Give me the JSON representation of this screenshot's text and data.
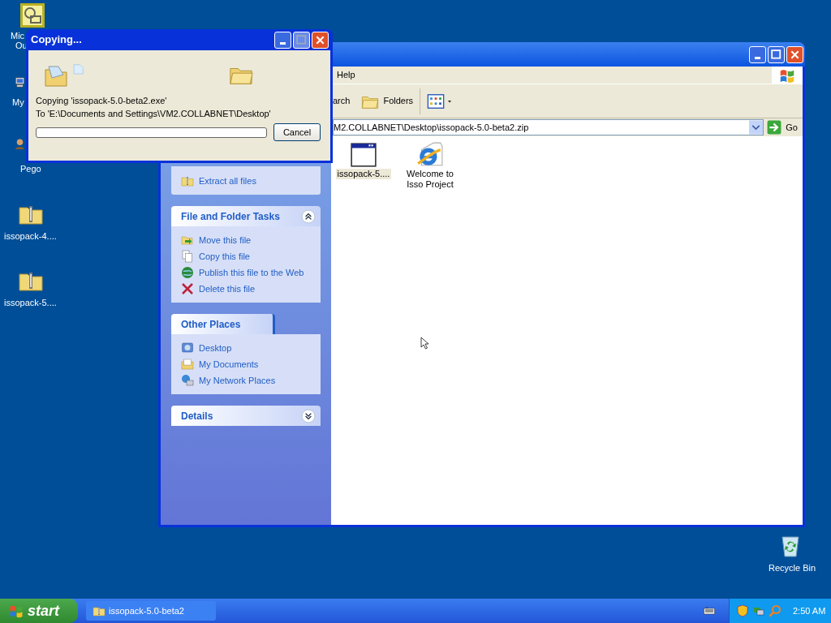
{
  "desktop_icons": [
    {
      "kind": "calendar",
      "lines": [
        "Mic",
        "Ou"
      ]
    },
    {
      "kind": "computer",
      "lines": [
        "My"
      ]
    },
    {
      "kind": "person",
      "lines": [
        "Pego"
      ]
    },
    {
      "kind": "zip",
      "lines": [
        "issopack-4...."
      ]
    },
    {
      "kind": "zip",
      "lines": [
        "issopack-5...."
      ]
    },
    {
      "kind": "recycle",
      "lines": [
        "Recycle Bin"
      ]
    }
  ],
  "explorer": {
    "menu": [
      "Help"
    ],
    "toolbar": [
      {
        "kind": "text",
        "label": "arch"
      },
      {
        "kind": "folders",
        "label": "Folders"
      },
      {
        "kind": "views"
      }
    ],
    "address": "M2.COLLABNET\\Desktop\\issopack-5.0-beta2.zip",
    "go": "Go",
    "panels": [
      {
        "items": [
          {
            "kind": "zip",
            "label": "Extract all files"
          }
        ]
      },
      {
        "title": "File and Folder Tasks",
        "expanded": true,
        "items": [
          {
            "kind": "move",
            "label": "Move this file"
          },
          {
            "kind": "copy",
            "label": "Copy this file"
          },
          {
            "kind": "globe",
            "label": "Publish this file to the Web"
          },
          {
            "kind": "delete",
            "label": "Delete this file"
          }
        ]
      },
      {
        "title": "Other Places",
        "items": [
          {
            "kind": "desktop",
            "label": "Desktop"
          },
          {
            "kind": "docs",
            "label": "My Documents"
          },
          {
            "kind": "network",
            "label": "My Network Places"
          }
        ]
      },
      {
        "title": "Details",
        "expanded": false
      }
    ],
    "files": [
      {
        "kind": "window",
        "lines": [
          "issopack-5...."
        ],
        "selected": true
      },
      {
        "kind": "ie",
        "lines": [
          "Welcome to",
          "Isso Project"
        ],
        "selected": false
      }
    ]
  },
  "dialog": {
    "title": "Copying...",
    "lines": [
      "Copying 'issopack-5.0-beta2.exe'",
      "To 'E:\\Documents and Settings\\VM2.COLLABNET\\Desktop'"
    ],
    "progress": {
      "level": 0
    },
    "button": "Cancel"
  },
  "taskbar": {
    "start": "start",
    "tasks": [
      {
        "label": "issopack-5.0-beta2",
        "selected": false
      }
    ],
    "clock": "2:50 AM"
  }
}
